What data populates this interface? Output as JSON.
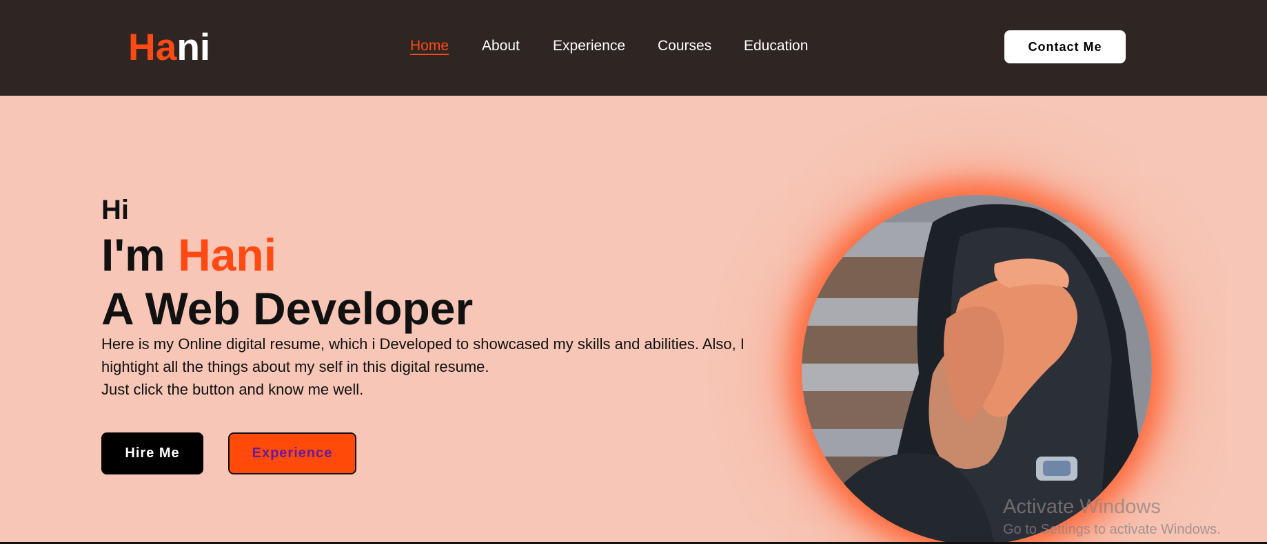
{
  "header": {
    "logo_accent": "Ha",
    "logo_rest": "ni",
    "nav": [
      {
        "label": "Home",
        "active": true
      },
      {
        "label": "About",
        "active": false
      },
      {
        "label": "Experience",
        "active": false
      },
      {
        "label": "Courses",
        "active": false
      },
      {
        "label": "Education",
        "active": false
      }
    ],
    "contact_label": "Contact Me"
  },
  "hero": {
    "greeting": "Hi",
    "intro_prefix": "I'm ",
    "name": "Hani",
    "role": "A Web Developer",
    "description_line1": "Here is my Online digital resume, which i Developed to showcased my skills and abilities. Also, I hightight all the things about my self in this digital resume.",
    "description_line2": "Just click the button and know me well.",
    "hire_label": "Hire Me",
    "experience_label": "Experience"
  },
  "watermark": {
    "title": "Activate Windows",
    "subtitle": "Go to Settings to activate Windows."
  },
  "colors": {
    "accent": "#ff4a14",
    "header_bg": "#2f2624",
    "page_bg": "#f7c6b6"
  }
}
